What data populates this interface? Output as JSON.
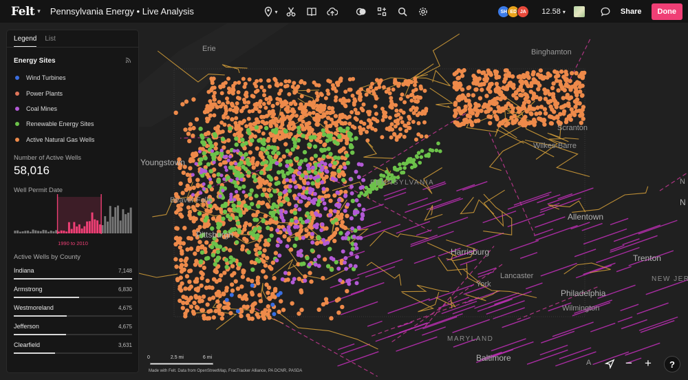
{
  "app": {
    "logo": "Felt",
    "title": "Pennsylvania Energy • Live Analysis"
  },
  "toolbar": {
    "tools": [
      "pin-icon",
      "scissors-icon",
      "book-icon",
      "upload-icon",
      "contrast-icon",
      "element-icon",
      "search-icon",
      "settings-icon"
    ],
    "collaborators": [
      {
        "initials": "SH",
        "color": "#3b7be8"
      },
      {
        "initials": "ED",
        "color": "#e8a21b"
      },
      {
        "initials": "JA",
        "color": "#e84a3b"
      }
    ],
    "zoom_level": "12.58",
    "share_label": "Share",
    "done_label": "Done"
  },
  "panel": {
    "tabs": [
      "Legend",
      "List"
    ],
    "section_title": "Energy Sites",
    "legend": [
      {
        "label": "Wind Turbines",
        "color": "#3b6ee0"
      },
      {
        "label": "Power Plants",
        "color": "#e0755a"
      },
      {
        "label": "Coal Mines",
        "color": "#b35ad6"
      },
      {
        "label": "Renewable Energy Sites",
        "color": "#6cc24a"
      },
      {
        "label": "Active Natural Gas Wells",
        "color": "#ee8a4a"
      }
    ],
    "stat_label": "Number of Active Wells",
    "stat_value": "58,016",
    "histogram_label": "Well Permit Date",
    "histogram_range": "1990 to 2010",
    "county_title": "Active Wells by County",
    "counties": [
      {
        "name": "Indiana",
        "value": "7,148",
        "ratio": 1.0
      },
      {
        "name": "Armstrong",
        "value": "6,830",
        "ratio": 0.55
      },
      {
        "name": "Westmoreland",
        "value": "4,675",
        "ratio": 0.45
      },
      {
        "name": "Jefferson",
        "value": "4,675",
        "ratio": 0.44
      },
      {
        "name": "Clearfield",
        "value": "3,631",
        "ratio": 0.35
      }
    ]
  },
  "map": {
    "places": {
      "erie": "Erie",
      "binghamton": "Binghamton",
      "scranton": "Scranton",
      "wilkes_barre": "Wilkes-Barre",
      "youngstown": "Youngstown",
      "pennsylvania": "PENNSYLVANIA",
      "beaver_falls": "Beaver Falls",
      "pittsburgh": "Pittsburgh",
      "allentown": "Allentown",
      "harrisburg": "Harrisburg",
      "lancaster": "Lancaster",
      "york": "York",
      "trenton": "Trenton",
      "new_jersey": "NEW JERS",
      "philadelphia": "Philadelphia",
      "wilmington": "Wilmington",
      "maryland": "MARYLAND",
      "baltimore": "Baltimore",
      "edge_n1": "N",
      "edge_n2": "N",
      "edge_a": "A"
    },
    "scale": {
      "start": "0",
      "mid": "2.5 mi",
      "end": "6 mi"
    },
    "attribution": "Made with Felt. Data from OpenStreetMap, FracTracker Alliance, PA DCNR, PASDA"
  },
  "controls": {
    "help": "?"
  }
}
